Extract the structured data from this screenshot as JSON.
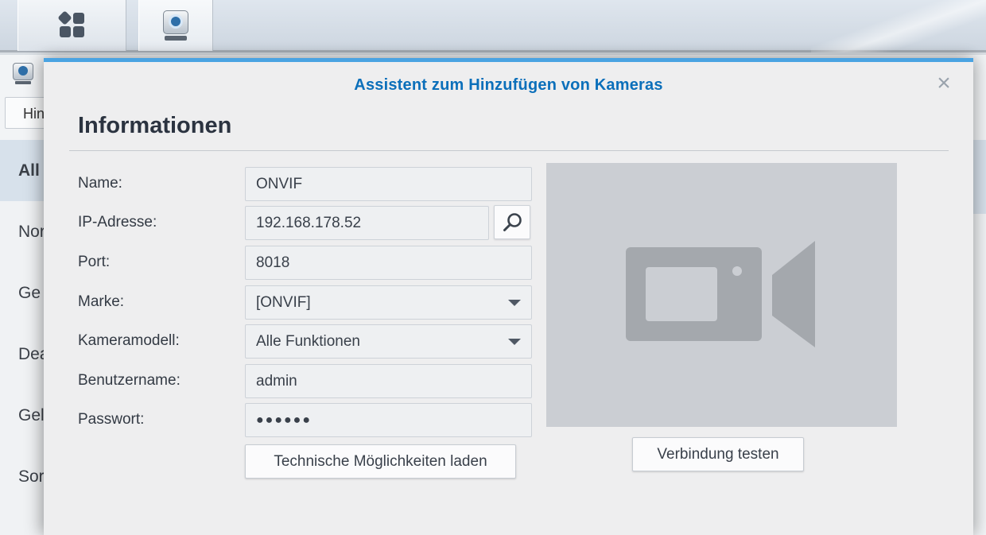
{
  "taskbar": {
    "apps": [
      {
        "name": "main-menu",
        "icon": "grid-icon"
      },
      {
        "name": "surveillance-station",
        "icon": "camera-app-icon"
      }
    ]
  },
  "background_window": {
    "button_label": "Hin",
    "sidebar_items": [
      "All",
      "Nor",
      "Ge",
      "Dea",
      "Gel",
      "Sor"
    ],
    "active_item_index": 0
  },
  "dialog": {
    "title": "Assistent zum Hinzufügen von Kameras",
    "close_icon": "close-icon",
    "heading": "Informationen",
    "fields": {
      "name": {
        "label": "Name:",
        "value": "ONVIF"
      },
      "ip": {
        "label": "IP-Adresse:",
        "value": "192.168.178.52"
      },
      "port": {
        "label": "Port:",
        "value": "8018"
      },
      "brand": {
        "label": "Marke:",
        "value": "[ONVIF]"
      },
      "model": {
        "label": "Kameramodell:",
        "value": "Alle Funktionen"
      },
      "username": {
        "label": "Benutzername:",
        "value": "admin"
      },
      "password": {
        "label": "Passwort:",
        "value": "●●●●●●"
      }
    },
    "load_capabilities_label": "Technische Möglichkeiten laden",
    "test_connection_label": "Verbindung testen",
    "preview_icon": "video-camera-icon"
  },
  "colors": {
    "accent": "#0b6fba",
    "dialog_top_border": "#4aa3e2",
    "preview_bg": "#cbced3",
    "preview_icon": "#a4a8ad"
  }
}
